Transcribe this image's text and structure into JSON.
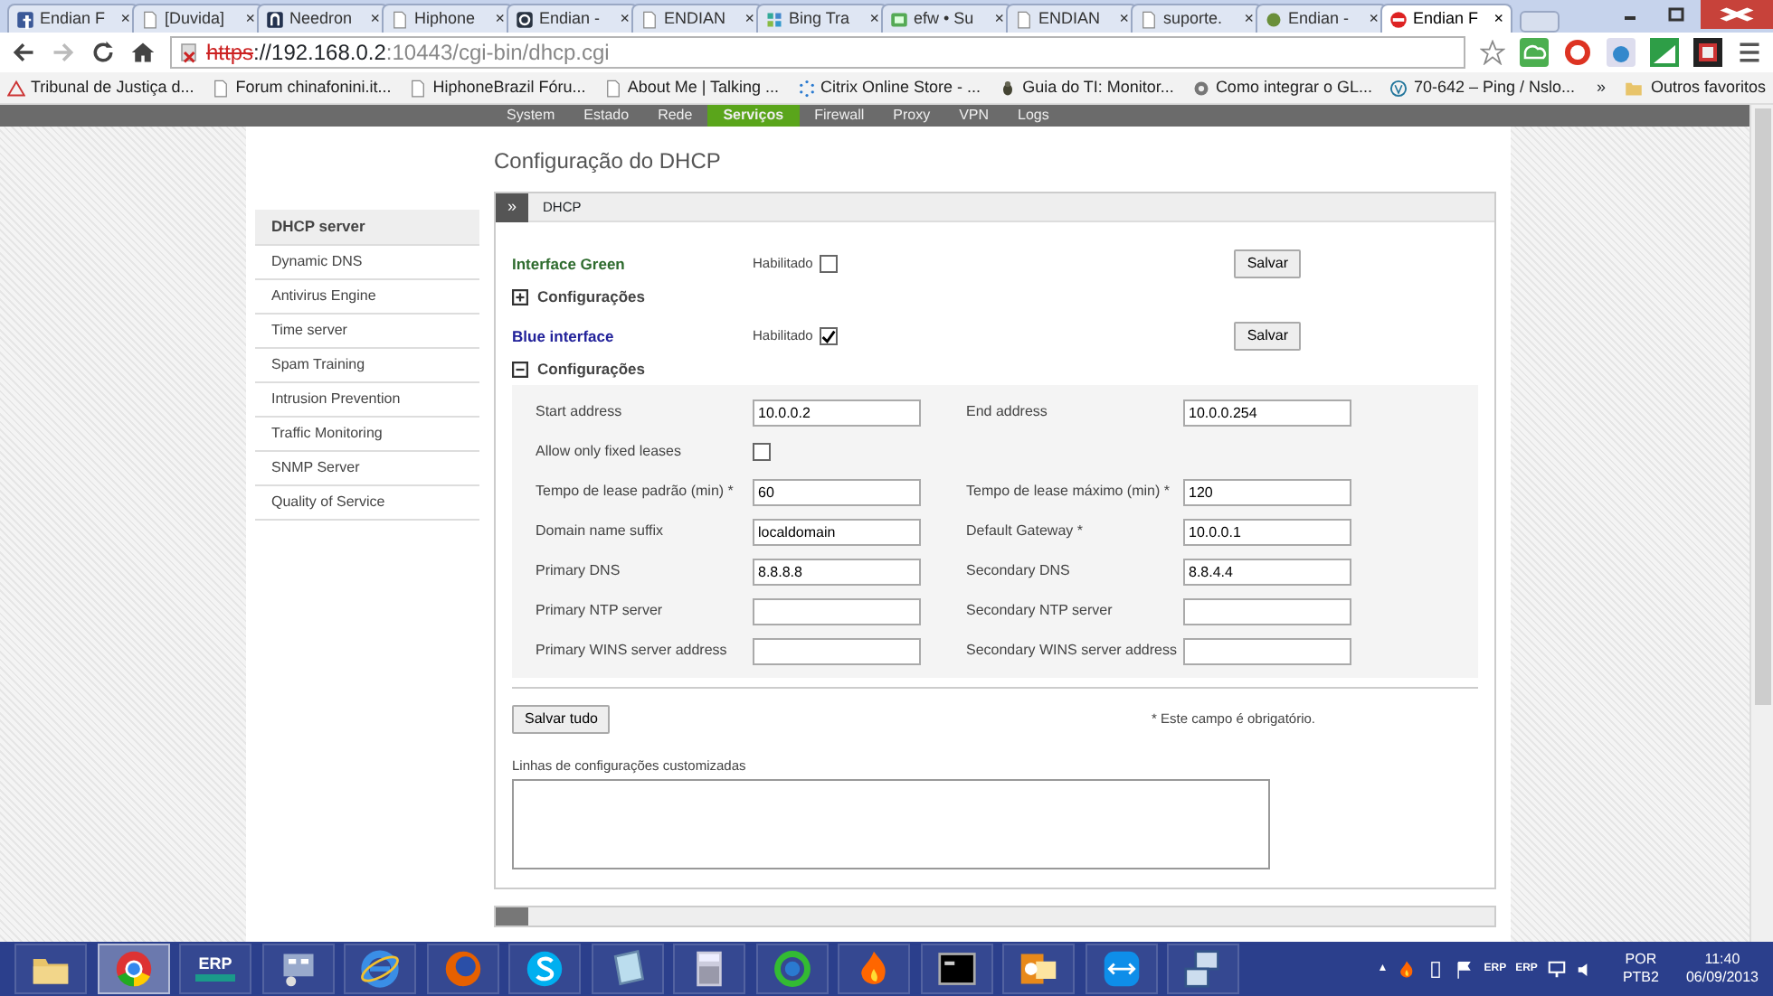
{
  "browser": {
    "tabs": [
      {
        "title": "Endian F",
        "kind": "facebook",
        "selected": false
      },
      {
        "title": "[Duvida]",
        "kind": "page",
        "selected": false
      },
      {
        "title": "Needron",
        "kind": "needron",
        "selected": false
      },
      {
        "title": "Hiphone",
        "kind": "page",
        "selected": false
      },
      {
        "title": "Endian -",
        "kind": "endian",
        "selected": false
      },
      {
        "title": "ENDIAN",
        "kind": "page",
        "selected": false
      },
      {
        "title": "Bing Tra",
        "kind": "bing",
        "selected": false
      },
      {
        "title": "efw • Su",
        "kind": "green",
        "selected": false
      },
      {
        "title": "ENDIAN",
        "kind": "page",
        "selected": false
      },
      {
        "title": "suporte.",
        "kind": "page",
        "selected": false
      },
      {
        "title": "Endian -",
        "kind": "dot",
        "selected": false
      },
      {
        "title": "Endian F",
        "kind": "stop",
        "selected": true
      }
    ],
    "close_glyph": "×",
    "url": {
      "scheme": "https",
      "host": "://192.168.0.2",
      "rest": ":10443/cgi-bin/dhcp.cgi"
    },
    "bookmarks": [
      {
        "label": "Tribunal de Justiça d...",
        "kind": "triangle"
      },
      {
        "label": "Forum chinafonini.it...",
        "kind": "page"
      },
      {
        "label": "HiphoneBrazil Fóru...",
        "kind": "page"
      },
      {
        "label": "About Me | Talking ...",
        "kind": "page"
      },
      {
        "label": "Citrix Online Store - ...",
        "kind": "citrix"
      },
      {
        "label": "Guia do TI: Monitor...",
        "kind": "bug"
      },
      {
        "label": "Como integrar o GL...",
        "kind": "gear"
      },
      {
        "label": "70-642 – Ping / Nslo...",
        "kind": "wordpress"
      }
    ],
    "bookmarks_more": "»",
    "other_bookmarks": "Outros favoritos"
  },
  "page": {
    "topnav": [
      {
        "label": "System",
        "selected": false
      },
      {
        "label": "Estado",
        "selected": false
      },
      {
        "label": "Rede",
        "selected": false
      },
      {
        "label": "Serviços",
        "selected": true
      },
      {
        "label": "Firewall",
        "selected": false
      },
      {
        "label": "Proxy",
        "selected": false
      },
      {
        "label": "VPN",
        "selected": false
      },
      {
        "label": "Logs",
        "selected": false
      }
    ],
    "title": "Configuração do DHCP",
    "sidebar": [
      {
        "label": "DHCP server",
        "selected": true
      },
      {
        "label": "Dynamic DNS",
        "selected": false
      },
      {
        "label": "Antivirus Engine",
        "selected": false
      },
      {
        "label": "Time server",
        "selected": false
      },
      {
        "label": "Spam Training",
        "selected": false
      },
      {
        "label": "Intrusion Prevention",
        "selected": false
      },
      {
        "label": "Traffic Monitoring",
        "selected": false
      },
      {
        "label": "SNMP Server",
        "selected": false
      },
      {
        "label": "Quality of Service",
        "selected": false
      }
    ],
    "panel": {
      "toggle": "»",
      "title": "DHCP",
      "interfaces": [
        {
          "name": "Interface Green",
          "color": "#2e6b2e",
          "enabled_label": "Habilitado",
          "checked": false,
          "save": "Salvar",
          "settings_label": "Configurações",
          "expanded": false
        },
        {
          "name": "Blue interface",
          "color": "#22229a",
          "enabled_label": "Habilitado",
          "checked": true,
          "save": "Salvar",
          "settings_label": "Configurações",
          "expanded": true,
          "rows": [
            [
              {
                "kind": "input",
                "label": "Start address",
                "value": "10.0.0.2"
              },
              {
                "kind": "input",
                "label": "End address",
                "value": "10.0.0.254"
              }
            ],
            [
              {
                "kind": "checkbox",
                "label": "Allow only fixed leases",
                "checked": false
              }
            ],
            [
              {
                "kind": "input",
                "label": "Tempo de lease padrão (min) *",
                "value": "60"
              },
              {
                "kind": "input",
                "label": "Tempo de lease máximo (min) *",
                "value": "120"
              }
            ],
            [
              {
                "kind": "input",
                "label": "Domain name suffix",
                "value": "localdomain"
              },
              {
                "kind": "input",
                "label": "Default Gateway *",
                "value": "10.0.0.1"
              }
            ],
            [
              {
                "kind": "input",
                "label": "Primary DNS",
                "value": "8.8.8.8"
              },
              {
                "kind": "input",
                "label": "Secondary DNS",
                "value": "8.8.4.4"
              }
            ],
            [
              {
                "kind": "input",
                "label": "Primary NTP server"
              },
              {
                "kind": "input",
                "label": "Secondary NTP server"
              }
            ],
            [
              {
                "kind": "input",
                "label": "Primary WINS server address"
              },
              {
                "kind": "input",
                "label": "Secondary WINS server address"
              }
            ]
          ]
        }
      ],
      "save_all": "Salvar tudo",
      "required_note": "* Este campo é obrigatório.",
      "custom_label": "Linhas de configurações customizadas"
    }
  },
  "taskbar": {
    "apps": [
      {
        "kind": "folder",
        "selected": false
      },
      {
        "kind": "chrome",
        "selected": true
      },
      {
        "kind": "erp",
        "label": "ERP",
        "selected": false
      },
      {
        "kind": "monitor",
        "selected": false
      },
      {
        "kind": "ie",
        "selected": false
      },
      {
        "kind": "firefox",
        "selected": false
      },
      {
        "kind": "skype",
        "selected": false
      },
      {
        "kind": "notepad",
        "selected": false
      },
      {
        "kind": "calculator",
        "selected": false
      },
      {
        "kind": "sync",
        "selected": false
      },
      {
        "kind": "flame",
        "selected": false
      },
      {
        "kind": "terminal",
        "selected": false
      },
      {
        "kind": "outlook",
        "selected": false
      },
      {
        "kind": "teamviewer",
        "selected": false
      },
      {
        "kind": "network",
        "selected": false
      }
    ],
    "tray": {
      "expand": "▲",
      "erp_labels": [
        "ERP",
        "ERP"
      ],
      "lang": "POR",
      "layout": "PTB2",
      "time": "11:40",
      "date": "06/09/2013"
    }
  }
}
